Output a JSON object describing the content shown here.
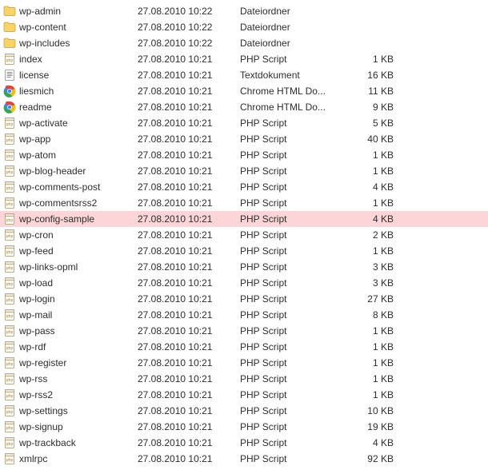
{
  "files": [
    {
      "name": "wp-admin",
      "date": "27.08.2010 10:22",
      "type": "Dateiordner",
      "size": "",
      "icon": "folder",
      "selected": false
    },
    {
      "name": "wp-content",
      "date": "27.08.2010 10:22",
      "type": "Dateiordner",
      "size": "",
      "icon": "folder",
      "selected": false
    },
    {
      "name": "wp-includes",
      "date": "27.08.2010 10:22",
      "type": "Dateiordner",
      "size": "",
      "icon": "folder",
      "selected": false
    },
    {
      "name": "index",
      "date": "27.08.2010 10:21",
      "type": "PHP Script",
      "size": "1 KB",
      "icon": "php",
      "selected": false
    },
    {
      "name": "license",
      "date": "27.08.2010 10:21",
      "type": "Textdokument",
      "size": "16 KB",
      "icon": "text",
      "selected": false
    },
    {
      "name": "liesmich",
      "date": "27.08.2010 10:21",
      "type": "Chrome HTML Do...",
      "size": "11 KB",
      "icon": "chrome",
      "selected": false
    },
    {
      "name": "readme",
      "date": "27.08.2010 10:21",
      "type": "Chrome HTML Do...",
      "size": "9 KB",
      "icon": "chrome",
      "selected": false
    },
    {
      "name": "wp-activate",
      "date": "27.08.2010 10:21",
      "type": "PHP Script",
      "size": "5 KB",
      "icon": "php",
      "selected": false
    },
    {
      "name": "wp-app",
      "date": "27.08.2010 10:21",
      "type": "PHP Script",
      "size": "40 KB",
      "icon": "php",
      "selected": false
    },
    {
      "name": "wp-atom",
      "date": "27.08.2010 10:21",
      "type": "PHP Script",
      "size": "1 KB",
      "icon": "php",
      "selected": false
    },
    {
      "name": "wp-blog-header",
      "date": "27.08.2010 10:21",
      "type": "PHP Script",
      "size": "1 KB",
      "icon": "php",
      "selected": false
    },
    {
      "name": "wp-comments-post",
      "date": "27.08.2010 10:21",
      "type": "PHP Script",
      "size": "4 KB",
      "icon": "php",
      "selected": false
    },
    {
      "name": "wp-commentsrss2",
      "date": "27.08.2010 10:21",
      "type": "PHP Script",
      "size": "1 KB",
      "icon": "php",
      "selected": false
    },
    {
      "name": "wp-config-sample",
      "date": "27.08.2010 10:21",
      "type": "PHP Script",
      "size": "4 KB",
      "icon": "php",
      "selected": true
    },
    {
      "name": "wp-cron",
      "date": "27.08.2010 10:21",
      "type": "PHP Script",
      "size": "2 KB",
      "icon": "php",
      "selected": false
    },
    {
      "name": "wp-feed",
      "date": "27.08.2010 10:21",
      "type": "PHP Script",
      "size": "1 KB",
      "icon": "php",
      "selected": false
    },
    {
      "name": "wp-links-opml",
      "date": "27.08.2010 10:21",
      "type": "PHP Script",
      "size": "3 KB",
      "icon": "php",
      "selected": false
    },
    {
      "name": "wp-load",
      "date": "27.08.2010 10:21",
      "type": "PHP Script",
      "size": "3 KB",
      "icon": "php",
      "selected": false
    },
    {
      "name": "wp-login",
      "date": "27.08.2010 10:21",
      "type": "PHP Script",
      "size": "27 KB",
      "icon": "php",
      "selected": false
    },
    {
      "name": "wp-mail",
      "date": "27.08.2010 10:21",
      "type": "PHP Script",
      "size": "8 KB",
      "icon": "php",
      "selected": false
    },
    {
      "name": "wp-pass",
      "date": "27.08.2010 10:21",
      "type": "PHP Script",
      "size": "1 KB",
      "icon": "php",
      "selected": false
    },
    {
      "name": "wp-rdf",
      "date": "27.08.2010 10:21",
      "type": "PHP Script",
      "size": "1 KB",
      "icon": "php",
      "selected": false
    },
    {
      "name": "wp-register",
      "date": "27.08.2010 10:21",
      "type": "PHP Script",
      "size": "1 KB",
      "icon": "php",
      "selected": false
    },
    {
      "name": "wp-rss",
      "date": "27.08.2010 10:21",
      "type": "PHP Script",
      "size": "1 KB",
      "icon": "php",
      "selected": false
    },
    {
      "name": "wp-rss2",
      "date": "27.08.2010 10:21",
      "type": "PHP Script",
      "size": "1 KB",
      "icon": "php",
      "selected": false
    },
    {
      "name": "wp-settings",
      "date": "27.08.2010 10:21",
      "type": "PHP Script",
      "size": "10 KB",
      "icon": "php",
      "selected": false
    },
    {
      "name": "wp-signup",
      "date": "27.08.2010 10:21",
      "type": "PHP Script",
      "size": "19 KB",
      "icon": "php",
      "selected": false
    },
    {
      "name": "wp-trackback",
      "date": "27.08.2010 10:21",
      "type": "PHP Script",
      "size": "4 KB",
      "icon": "php",
      "selected": false
    },
    {
      "name": "xmlrpc",
      "date": "27.08.2010 10:21",
      "type": "PHP Script",
      "size": "92 KB",
      "icon": "php",
      "selected": false
    }
  ]
}
